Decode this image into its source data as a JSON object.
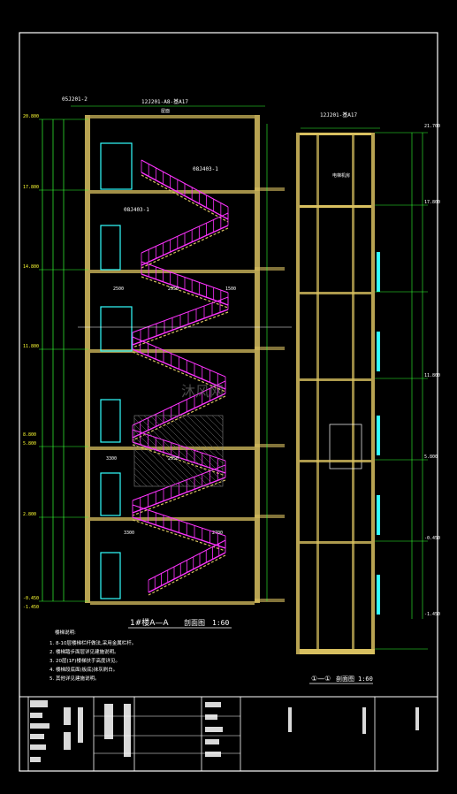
{
  "colors": {
    "background": "#000000",
    "frame": "#ffffff",
    "wall": "#d8c060",
    "stair": "#ff33ff",
    "dimension": "#33ff33",
    "door": "#33ffff",
    "elevation_text": "#ffff33",
    "section_title": "#ffffff",
    "notes": "#ffffff"
  },
  "sheet": {
    "section_left": {
      "title": "1#楼A—A",
      "subtitle": "剖面图",
      "scale": "1:60",
      "top_ref": "12J201-A8-基A17",
      "callout": "05J201-2",
      "roof_label": "屋面",
      "stair_ref_1": "08J403-1",
      "stair_ref_2": "08J403-1",
      "dims": [
        "2500",
        "2950",
        "1500",
        "3300",
        "2950",
        "3300",
        "2700"
      ],
      "levels": [
        "20.800",
        "17.800",
        "14.800",
        "11.800",
        "8.800",
        "5.800",
        "2.800",
        "-0.450",
        "-1.450"
      ]
    },
    "section_right": {
      "title": "①—①",
      "subtitle": "剖面图",
      "scale": "1:60",
      "top_ref": "12J201-基A17",
      "shaft_label": "电梯机房",
      "levels": [
        "21.700",
        "17.800",
        "11.800",
        "5.800",
        "-0.450",
        "-1.450"
      ]
    },
    "notes": {
      "header": "楼梯说明:",
      "lines": [
        "1. 8-10层楼梯栏杆做法,采用金属栏杆。",
        "2. 楼梯踏步面层详见建施说明。",
        "3. 20层(1F)楼梯扶手高度详见。",
        "4. 楼梯段底面(板底)抹灰刷白。",
        "5. 其他详见建施说明。"
      ]
    },
    "watermark": "沐风网",
    "title_block": {
      "label_cells": [
        "",
        "",
        "",
        "",
        "",
        ""
      ]
    }
  }
}
